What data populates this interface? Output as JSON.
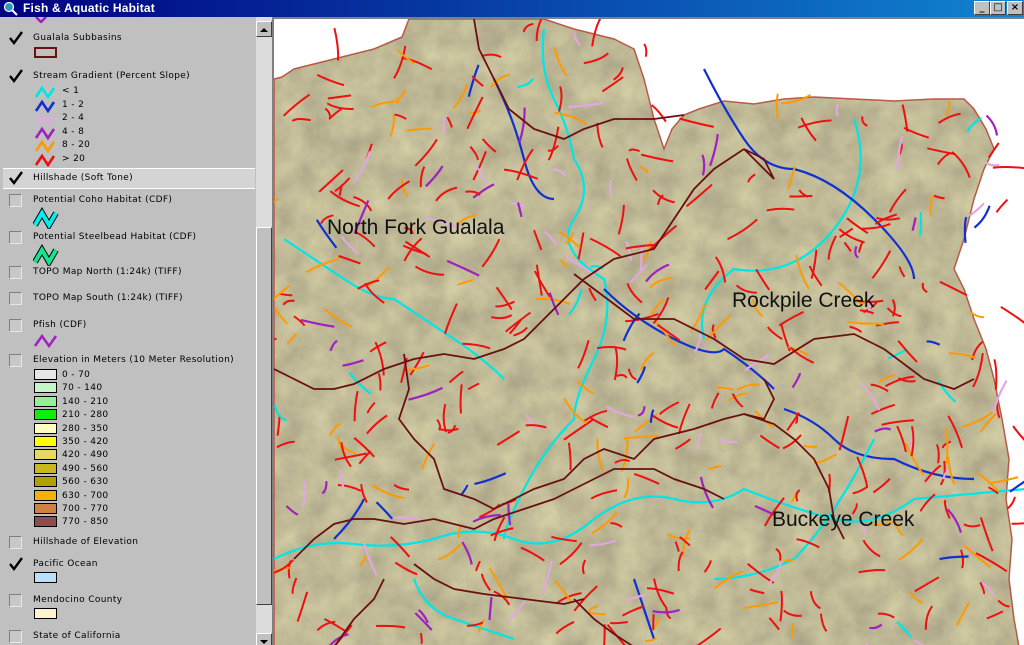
{
  "window": {
    "title": "Fish & Aquatic Habitat",
    "buttons": {
      "minimize": "_",
      "maximize": "□",
      "close": "×"
    }
  },
  "toc": {
    "layers": [
      {
        "name": "Gualala Subbasins",
        "checked": true
      },
      {
        "name": "Stream Gradient (Percent Slope)",
        "checked": true,
        "legend": [
          {
            "label": "< 1",
            "color": "#00e5e5"
          },
          {
            "label": "1 - 2",
            "color": "#1030d0"
          },
          {
            "label": "2 - 4",
            "color": "#e0a8e0"
          },
          {
            "label": "4 - 8",
            "color": "#a020c0"
          },
          {
            "label": "8 - 20",
            "color": "#ff9900"
          },
          {
            "label": "> 20",
            "color": "#ee1010"
          }
        ]
      },
      {
        "name": "Hillshade (Soft Tone)",
        "checked": true
      },
      {
        "name": "Potential Coho Habitat (CDF)",
        "checked": false
      },
      {
        "name": "Potential Steelbead Habitat (CDF)",
        "checked": false
      },
      {
        "name": "TOPO Map North (1:24k) (TIFF)",
        "checked": false
      },
      {
        "name": "TOPO Map South (1:24k) (TIFF)",
        "checked": false
      },
      {
        "name": "Pfish (CDF)",
        "checked": false
      },
      {
        "name": "Elevation in Meters (10 Meter Resolution)",
        "checked": false,
        "legend": [
          {
            "label": "0 - 70",
            "color": "#e6e6e6"
          },
          {
            "label": "70 - 140",
            "color": "#c8f5c8"
          },
          {
            "label": "140 - 210",
            "color": "#96ee96"
          },
          {
            "label": "210 - 280",
            "color": "#10ee10"
          },
          {
            "label": "280 - 350",
            "color": "#ffffc0"
          },
          {
            "label": "350 - 420",
            "color": "#ffff00"
          },
          {
            "label": "420 - 490",
            "color": "#e8d860"
          },
          {
            "label": "490 - 560",
            "color": "#c8b820"
          },
          {
            "label": "560 - 630",
            "color": "#b0a000"
          },
          {
            "label": "630 - 700",
            "color": "#f5b000"
          },
          {
            "label": "700 - 770",
            "color": "#d08040"
          },
          {
            "label": "770 - 850",
            "color": "#8a4e4e"
          }
        ]
      },
      {
        "name": "Hillshade of Elevation",
        "checked": false
      },
      {
        "name": "Pacific Ocean",
        "checked": true,
        "swatch": "#b8e0f8"
      },
      {
        "name": "Mendocino County",
        "checked": false,
        "swatch": "#fff4d0"
      },
      {
        "name": "State of California",
        "checked": false
      }
    ]
  },
  "map": {
    "labels": [
      "North Fork Gualala",
      "Rockpile Creek",
      "Buckeye Creek"
    ],
    "colors": {
      "terrain": "#d8d2a8",
      "subbasin_outline": "#6a1010",
      "county_line": "#b85a48"
    }
  }
}
